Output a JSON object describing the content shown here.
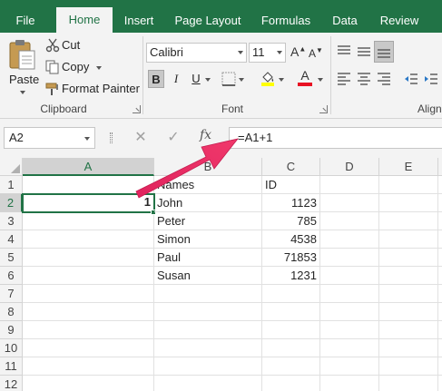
{
  "tabs": [
    "File",
    "Home",
    "Insert",
    "Page Layout",
    "Formulas",
    "Data",
    "Review"
  ],
  "active_tab": "Home",
  "clipboard": {
    "paste_label": "Paste",
    "cut_label": "Cut",
    "copy_label": "Copy",
    "format_painter_label": "Format Painter",
    "group_label": "Clipboard"
  },
  "font": {
    "font_name": "Calibri",
    "font_size": "11",
    "group_label": "Font",
    "bold": "B",
    "italic": "I",
    "underline": "U",
    "font_color_glyph": "A"
  },
  "alignment": {
    "group_label": "Align"
  },
  "formula_bar": {
    "name_box": "A2",
    "cancel": "✕",
    "enter": "✓",
    "fx": "fx",
    "formula": "=A1+1"
  },
  "sheet": {
    "columns": [
      "A",
      "B",
      "C",
      "D",
      "E"
    ],
    "selected_column": "A",
    "rows": [
      "1",
      "2",
      "3",
      "4",
      "5",
      "6",
      "7",
      "8",
      "9",
      "10",
      "11",
      "12"
    ],
    "selected_row": "2",
    "cells": {
      "A2": "1",
      "B1": "Names",
      "C1": "ID",
      "B2": "John",
      "C2": "1123",
      "B3": "Peter",
      "C3": "785",
      "B4": "Simon",
      "C4": "4538",
      "B5": "Paul",
      "C5": "71853",
      "B6": "Susan",
      "C6": "1231"
    }
  },
  "colors": {
    "accent": "#217346",
    "annotation_arrow": "#f0386b"
  }
}
